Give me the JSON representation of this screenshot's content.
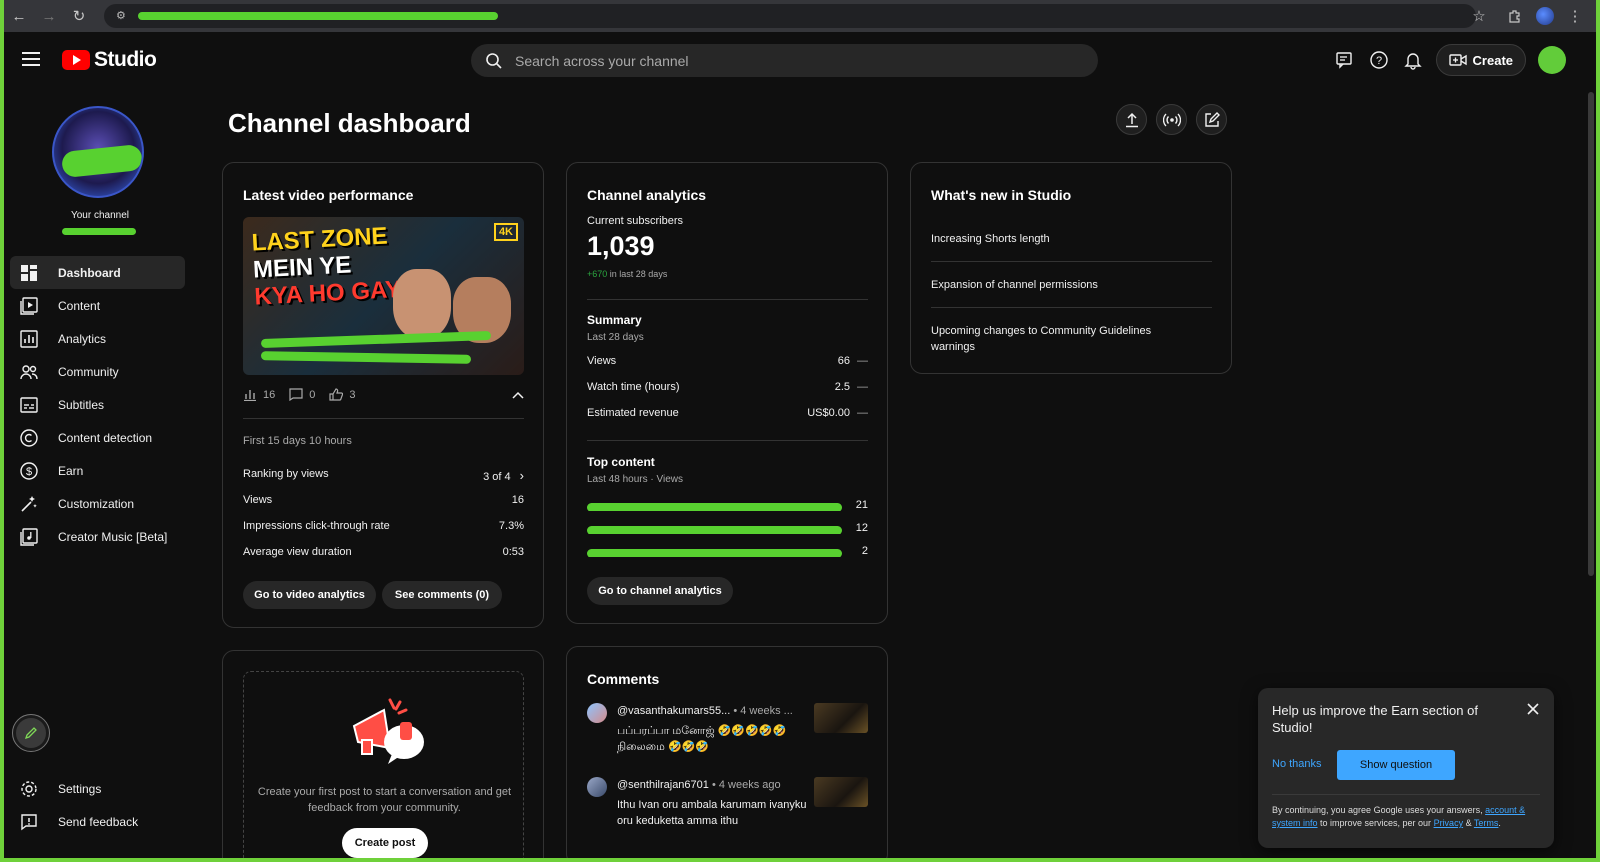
{
  "browser": {
    "icons": [
      "back-arrow-icon",
      "forward-arrow-icon",
      "reload-icon",
      "site-settings-icon",
      "bookmark-star-icon",
      "extensions-icon",
      "profile-icon",
      "kebab-menu-icon"
    ]
  },
  "header": {
    "logo_text": "Studio",
    "search_placeholder": "Search across your channel",
    "create_label": "Create"
  },
  "sidebar": {
    "your_channel_label": "Your channel",
    "items": [
      {
        "label": "Dashboard",
        "icon": "dashboard-icon",
        "active": true
      },
      {
        "label": "Content",
        "icon": "content-icon"
      },
      {
        "label": "Analytics",
        "icon": "analytics-icon"
      },
      {
        "label": "Community",
        "icon": "community-icon"
      },
      {
        "label": "Subtitles",
        "icon": "subtitles-icon"
      },
      {
        "label": "Content detection",
        "icon": "copyright-icon"
      },
      {
        "label": "Earn",
        "icon": "dollar-icon"
      },
      {
        "label": "Customization",
        "icon": "magic-wand-icon"
      },
      {
        "label": "Creator Music [Beta]",
        "icon": "music-library-icon"
      }
    ],
    "bottom_items": [
      {
        "label": "Settings",
        "icon": "gear-icon"
      },
      {
        "label": "Send feedback",
        "icon": "feedback-icon"
      }
    ]
  },
  "main": {
    "title": "Channel dashboard"
  },
  "latest_video": {
    "title": "Latest video performance",
    "thumbnail_line1": "LAST ZONE",
    "thumbnail_line2": "MEIN YE",
    "thumbnail_line3": "KYA HO GAYA?",
    "thumbnail_badge": "4K",
    "views_count": "16",
    "comments_count": "0",
    "likes_count": "3",
    "period": "First 15 days 10 hours",
    "rows": [
      {
        "label": "Ranking by views",
        "value": "3 of 4"
      },
      {
        "label": "Views",
        "value": "16"
      },
      {
        "label": "Impressions click-through rate",
        "value": "7.3%"
      },
      {
        "label": "Average view duration",
        "value": "0:53"
      }
    ],
    "btn_analytics": "Go to video analytics",
    "btn_comments": "See comments (0)"
  },
  "channel_analytics": {
    "title": "Channel analytics",
    "subs_label": "Current subscribers",
    "subs_value": "1,039",
    "subs_delta": "+670",
    "subs_delta_suffix": " in last 28 days",
    "summary_title": "Summary",
    "summary_period": "Last 28 days",
    "summary_rows": [
      {
        "label": "Views",
        "value": "66",
        "trend": "—"
      },
      {
        "label": "Watch time (hours)",
        "value": "2.5",
        "trend": "—"
      },
      {
        "label": "Estimated revenue",
        "value": "US$0.00",
        "trend": "—"
      }
    ],
    "top_title": "Top content",
    "top_period": "Last 48 hours · Views",
    "top_items": [
      {
        "value": "21"
      },
      {
        "value": "12"
      },
      {
        "value": "2"
      }
    ],
    "btn": "Go to channel analytics"
  },
  "whats_new": {
    "title": "What's new in Studio",
    "items": [
      "Increasing Shorts length",
      "Expansion of channel permissions",
      "Upcoming changes to Community Guidelines warnings"
    ]
  },
  "community_post": {
    "text": "Create your first post to start a conversation and get feedback from your community.",
    "btn": "Create post"
  },
  "comments": {
    "title": "Comments",
    "items": [
      {
        "user": "@vasanthakumars55...",
        "time": "• 4 weeks ...",
        "text": "பப்பரப்பா மனோஜ் 🤣🤣🤣🤣🤣 நிலைமை 🤣🤣🤣"
      },
      {
        "user": "@senthilrajan6701",
        "time": "• 4 weeks ago",
        "text": "Ithu Ivan oru ambala karumam ivanyku oru keduketta amma ithu"
      }
    ]
  },
  "feedback_toast": {
    "title": "Help us improve the Earn section of Studio!",
    "no_thanks": "No thanks",
    "show_question": "Show question",
    "legal_prefix": "By continuing, you agree Google uses your answers, ",
    "legal_link1": "account & system info",
    "legal_mid": " to improve services, per our ",
    "legal_link2": "Privacy",
    "legal_amp": " & ",
    "legal_link3": "Terms",
    "legal_end": "."
  },
  "colors": {
    "background": "#0f0f0f",
    "card_border": "#333333",
    "accent_blue": "#3ea6ff",
    "delta_green": "#2ba640",
    "brand_red": "#ff0000"
  }
}
